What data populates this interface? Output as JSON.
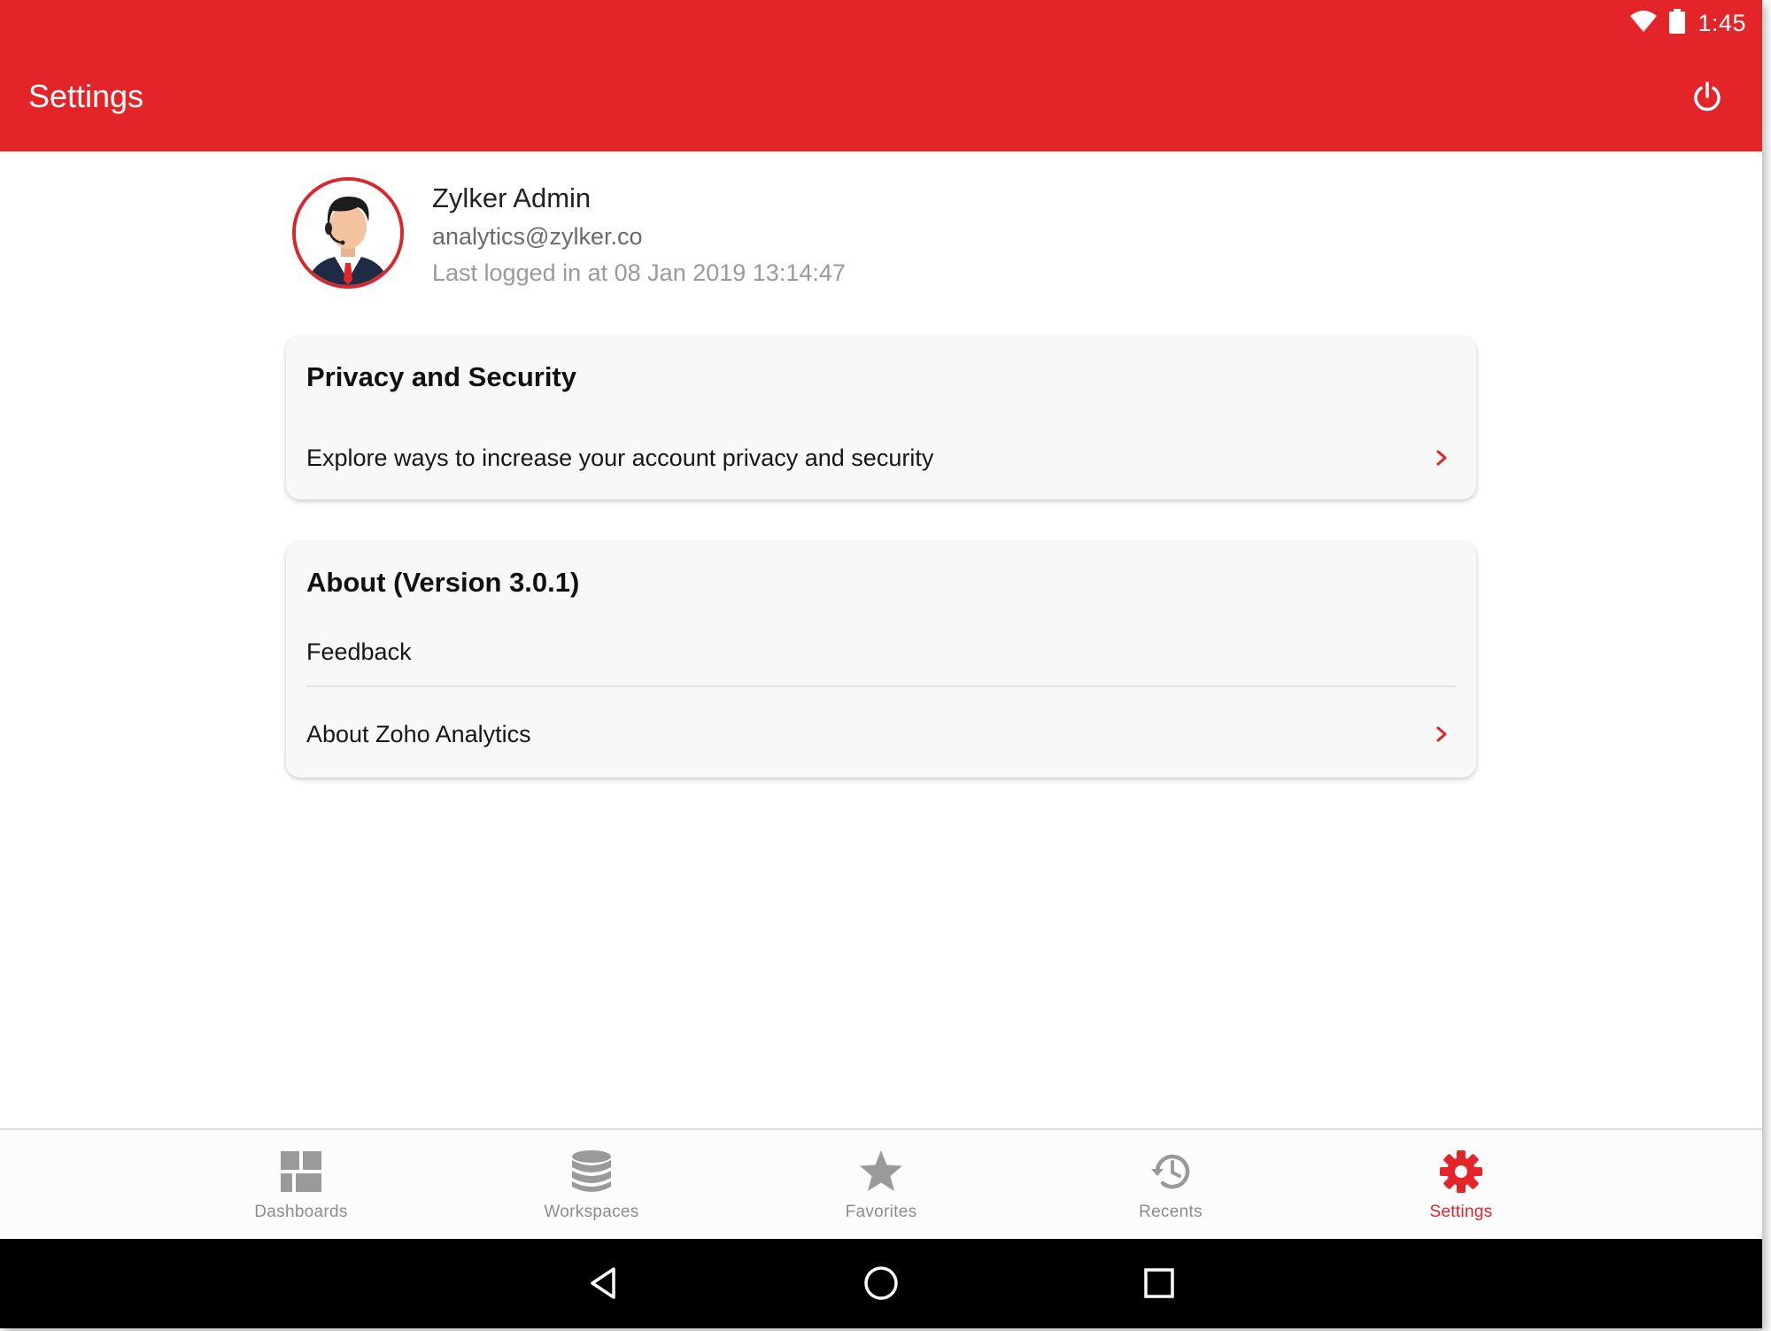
{
  "status_bar": {
    "time": "1:45",
    "icons": [
      "wifi-icon",
      "battery-icon"
    ]
  },
  "header": {
    "title": "Settings",
    "power_icon": "power-icon",
    "background_color": "#e32428"
  },
  "profile": {
    "name": "Zylker Admin",
    "email": "analytics@zylker.co",
    "last_login": "Last logged in at 08 Jan 2019 13:14:47"
  },
  "privacy_card": {
    "title": "Privacy and Security",
    "row_label": "Explore ways to increase your account privacy and security"
  },
  "about_card": {
    "title": "About (Version 3.0.1)",
    "rows": [
      {
        "label": "Feedback"
      },
      {
        "label": "About Zoho Analytics"
      }
    ]
  },
  "bottom_nav": {
    "items": [
      {
        "label": "Dashboards",
        "icon": "dashboards-icon",
        "active": false
      },
      {
        "label": "Workspaces",
        "icon": "workspaces-icon",
        "active": false
      },
      {
        "label": "Favorites",
        "icon": "star-icon",
        "active": false
      },
      {
        "label": "Recents",
        "icon": "history-icon",
        "active": false
      },
      {
        "label": "Settings",
        "icon": "gear-icon",
        "active": true
      }
    ],
    "active_color": "#e32428",
    "inactive_color": "#8d8d8d"
  },
  "system_nav": {
    "icons": [
      "back-icon",
      "home-icon",
      "recents-square-icon"
    ]
  }
}
